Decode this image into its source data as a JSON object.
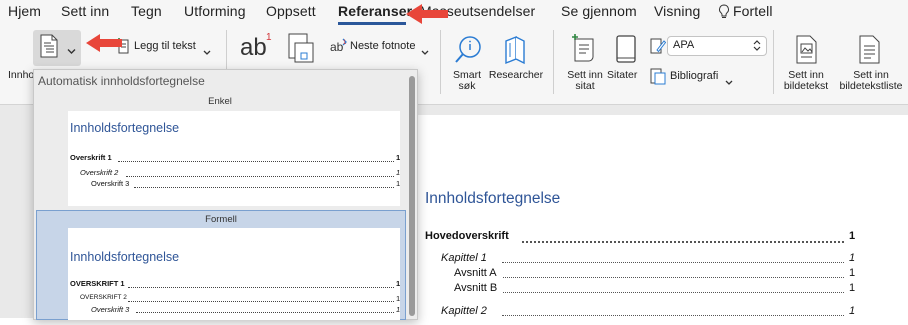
{
  "tabs": [
    {
      "label": "Hjem"
    },
    {
      "label": "Sett inn"
    },
    {
      "label": "Tegn"
    },
    {
      "label": "Utforming"
    },
    {
      "label": "Oppsett"
    },
    {
      "label": "Referanser",
      "active": true
    },
    {
      "label": "Masseutsendelser"
    },
    {
      "label": "Se gjennom"
    },
    {
      "label": "Visning"
    },
    {
      "label": "Fortell"
    }
  ],
  "ribbon": {
    "toc_label_partial": "Innho",
    "add_text": "Legg til tekst",
    "footnote_icon_text": "ab",
    "footnote_superscript": "1",
    "next_footnote": "Neste fotnote",
    "smart_search_line1": "Smart",
    "smart_search_line2": "søk",
    "researcher": "Researcher",
    "insert_citation_line1": "Sett inn",
    "insert_citation_line2": "sitat",
    "citations": "Sitater",
    "style_value": "APA",
    "bibliography": "Bibliografi",
    "insert_caption_line1": "Sett inn",
    "insert_caption_line2": "bildetekst",
    "insert_table_of_figures_line1": "Sett inn",
    "insert_table_of_figures_line2": "bildetekstliste"
  },
  "dropdown": {
    "header": "Automatisk innholdsfortegnelse",
    "items": [
      {
        "name": "Enkel",
        "title": "Innholdsfortegnelse",
        "lines": [
          {
            "text": "Overskrift 1",
            "page": "1"
          },
          {
            "text": "Overskrift 2",
            "page": "1"
          },
          {
            "text": "Overskrift 3",
            "page": "1"
          }
        ]
      },
      {
        "name": "Formell",
        "title": "Innholdsfortegnelse",
        "lines": [
          {
            "text": "OVERSKRIFT 1",
            "page": "1"
          },
          {
            "text": "OVERSKRIFT 2",
            "page": "1"
          },
          {
            "text": "Overskrift 3",
            "page": "1"
          }
        ]
      }
    ]
  },
  "document": {
    "title": "Innholdsfortegnelse",
    "lines": [
      {
        "text": "Hovedoverskrift",
        "page": "1"
      },
      {
        "text": "Kapittel 1",
        "page": "1"
      },
      {
        "text": "Avsnitt A",
        "page": "1"
      },
      {
        "text": "Avsnitt B",
        "page": "1"
      },
      {
        "text": "Kapittel 2",
        "page": "1"
      }
    ]
  },
  "colors": {
    "accent": "#2b579a",
    "heading": "#2f5597",
    "arrow": "#e8463a"
  }
}
